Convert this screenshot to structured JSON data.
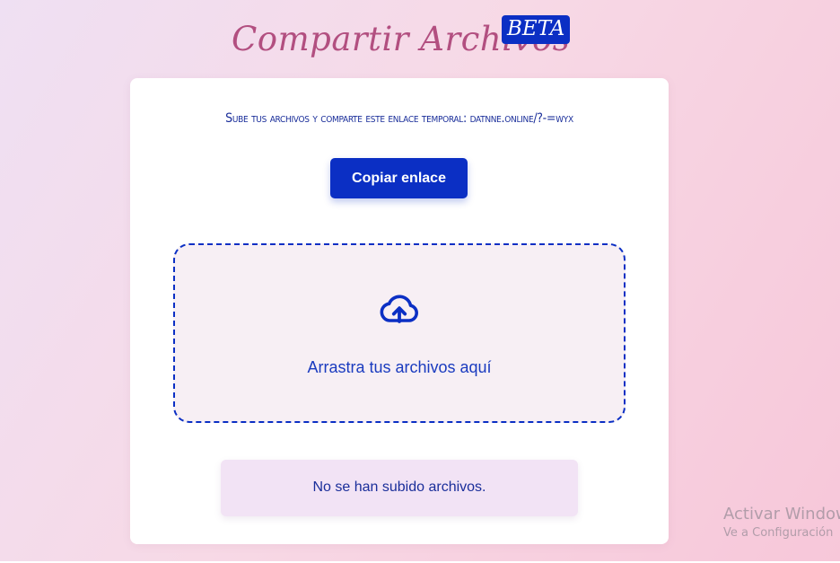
{
  "header": {
    "title": "Compartir Archivos",
    "badge": "BETA"
  },
  "card": {
    "instructions": "Sube tus archivos y comparte este enlace temporal: datnne.online/?-=wyx",
    "copy_button_label": "Copiar enlace",
    "dropzone": {
      "icon": "cloud-upload-icon",
      "text": "Arrastra tus archivos aquí"
    },
    "status_text": "No se han subido archivos."
  },
  "watermark": {
    "title": "Activar Windows",
    "subtitle": "Ve a Configuración"
  },
  "colors": {
    "accent": "#0b2fc4",
    "title": "#b24f80",
    "text": "#1a2e9a",
    "status_bg": "#f2e3f5",
    "dropzone_bg": "#f7eff4"
  }
}
